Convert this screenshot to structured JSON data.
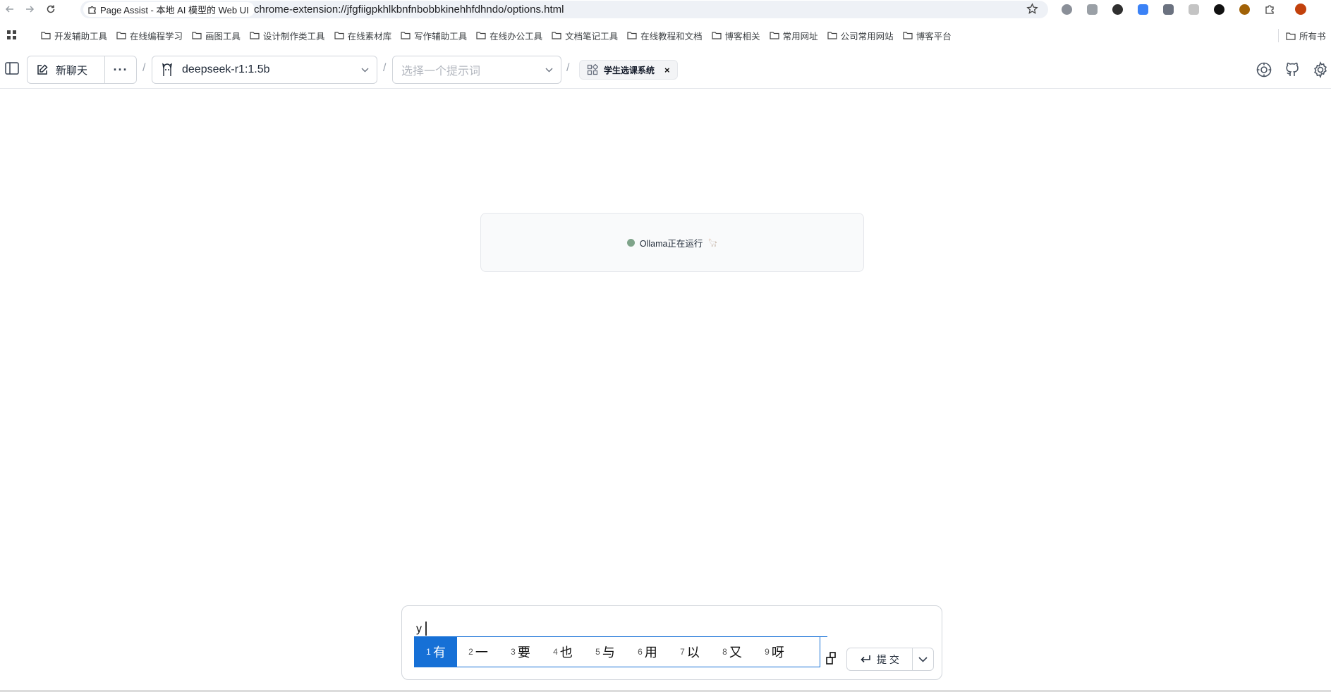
{
  "browser": {
    "tab_title": "Page Assist - 本地 AI 模型的 Web UI",
    "url": "chrome-extension://jfgfiigpkhlkbnfnbobbkinehhfdhndo/options.html",
    "bookmarks": [
      "开发辅助工具",
      "在线编程学习",
      "画图工具",
      "设计制作类工具",
      "在线素材库",
      "写作辅助工具",
      "在线办公工具",
      "文档笔记工具",
      "在线教程和文档",
      "博客相关",
      "常用网址",
      "公司常用网站",
      "博客平台"
    ],
    "bookmarks_more": "所有书",
    "extension_colors": [
      "#8a8f98",
      "#9aa0a6",
      "#2f2f2f",
      "#3b82f6",
      "#6b7280",
      "#c4c4c4",
      "#111111",
      "#a16207",
      "#c2410c"
    ]
  },
  "header": {
    "new_chat_label": "新聊天",
    "more_label": "···",
    "model_value": "deepseek-r1:1.5b",
    "prompt_placeholder": "选择一个提示词",
    "knowledge_tag": "学生选课系统",
    "knowledge_tag_close": "×"
  },
  "status": {
    "text": "Ollama正在运行",
    "emoji": "🦙",
    "dot_color": "#7fa48a"
  },
  "composer": {
    "typed_text": "y",
    "ime_candidates": [
      {
        "num": "1",
        "char": "有"
      },
      {
        "num": "2",
        "char": "一"
      },
      {
        "num": "3",
        "char": "要"
      },
      {
        "num": "4",
        "char": "也"
      },
      {
        "num": "5",
        "char": "与"
      },
      {
        "num": "6",
        "char": "用"
      },
      {
        "num": "7",
        "char": "以"
      },
      {
        "num": "8",
        "char": "又"
      },
      {
        "num": "9",
        "char": "呀"
      }
    ],
    "ime_selected_index": 0,
    "submit_label": "提 交"
  },
  "colors": {
    "accent": "#1670d6",
    "border": "#d1d5db"
  }
}
